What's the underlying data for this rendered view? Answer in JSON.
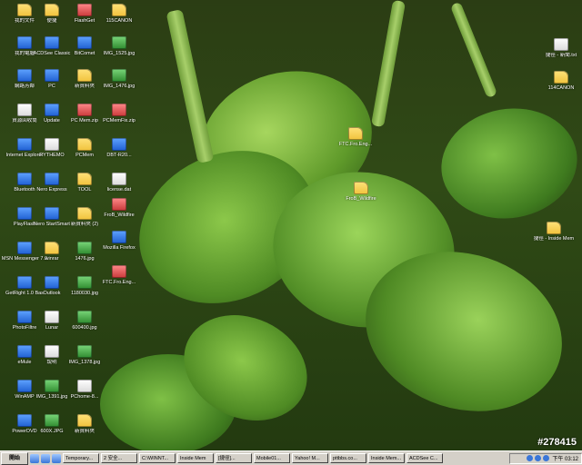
{
  "desktop": {
    "icons": [
      {
        "label": "我的文件",
        "type": "folder"
      },
      {
        "label": "我的電腦",
        "type": "app"
      },
      {
        "label": "網路芳鄰",
        "type": "app"
      },
      {
        "label": "資源回收筒",
        "type": "file"
      },
      {
        "label": "Internet Explorer",
        "type": "app"
      },
      {
        "label": "Bluetooth",
        "type": "app"
      },
      {
        "label": "PlayFlash",
        "type": "app"
      },
      {
        "label": "MSN Messenger 7.0",
        "type": "app"
      },
      {
        "label": "GetRight 1.0 Bas",
        "type": "app"
      },
      {
        "label": "PhotoFiltre",
        "type": "app"
      },
      {
        "label": "eMule",
        "type": "app"
      },
      {
        "label": "WinAMP",
        "type": "app"
      },
      {
        "label": "PowerDVD",
        "type": "app"
      },
      {
        "label": "便捷",
        "type": "folder"
      },
      {
        "label": "ACDSee Classic",
        "type": "app"
      },
      {
        "label": "PC",
        "type": "app"
      },
      {
        "label": "Update",
        "type": "app"
      },
      {
        "label": "RYTHEMO",
        "type": "file"
      },
      {
        "label": "Nero Express",
        "type": "app"
      },
      {
        "label": "Nero StartSmart",
        "type": "app"
      },
      {
        "label": "winrar",
        "type": "folder"
      },
      {
        "label": "Outlook",
        "type": "app"
      },
      {
        "label": "Lunar",
        "type": "file"
      },
      {
        "label": "說明",
        "type": "file"
      },
      {
        "label": "IMG_1391.jpg",
        "type": "img"
      },
      {
        "label": "600X.JPG",
        "type": "img"
      },
      {
        "label": "FlashGet",
        "type": "zip"
      },
      {
        "label": "BitComet",
        "type": "app"
      },
      {
        "label": "新資料夾",
        "type": "folder"
      },
      {
        "label": "PC Mem.zip",
        "type": "zip"
      },
      {
        "label": "PCMem",
        "type": "folder"
      },
      {
        "label": "TOOL",
        "type": "folder"
      },
      {
        "label": "新資料夾 (2)",
        "type": "folder"
      },
      {
        "label": "1476.jpg",
        "type": "img"
      },
      {
        "label": "1180030.jpg",
        "type": "img"
      },
      {
        "label": "600400.jpg",
        "type": "img"
      },
      {
        "label": "IMG_1378.jpg",
        "type": "img"
      },
      {
        "label": "PChome-8...",
        "type": "file"
      },
      {
        "label": "新資料夾",
        "type": "folder"
      },
      {
        "label": "115CANON",
        "type": "folder"
      },
      {
        "label": "IMG_1525.jpg",
        "type": "img"
      },
      {
        "label": "IMG_1476.jpg",
        "type": "img"
      },
      {
        "label": "PCMemFix.zip",
        "type": "zip"
      },
      {
        "label": "DBT-R20...",
        "type": "app"
      },
      {
        "label": "license.dat",
        "type": "file"
      },
      {
        "label": "FroB_Wildfire",
        "type": "zip"
      },
      {
        "label": "Mozilla Firefox",
        "type": "app"
      },
      {
        "label": "FTC.Fro.Eng...",
        "type": "zip"
      },
      {
        "label": "FTC.Fro.Eng...",
        "type": "folder"
      },
      {
        "label": "FroB_Wildfire",
        "type": "folder"
      },
      {
        "label": "捷徑 - 新聞.txt",
        "type": "file"
      },
      {
        "label": "114CANON",
        "type": "folder"
      },
      {
        "label": "捷徑 - Inside Mem",
        "type": "folder"
      }
    ]
  },
  "taskbar": {
    "start_label": "開始",
    "tasks": [
      "Temporary...",
      "2 安全...",
      "C:\\WINNT...",
      "Inside Mem",
      "[捷徑]...",
      "Mobile01...",
      "Yahoo! M...",
      "pttbbs.co...",
      "Inside Mem...",
      "ACDSee C..."
    ],
    "tray_icons": [
      "speaker-icon",
      "network-icon",
      "antivirus-icon"
    ],
    "clock": "下午 03:12"
  },
  "watermark": "#278415",
  "colors": {
    "taskbar": "#d4d0c8",
    "wallpaper": "#304a16"
  }
}
